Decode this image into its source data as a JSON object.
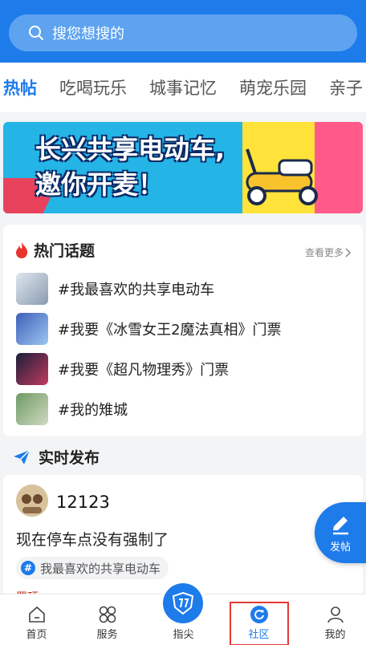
{
  "search": {
    "placeholder": "搜您想搜的"
  },
  "tabs": [
    {
      "label": "热帖",
      "active": true
    },
    {
      "label": "吃喝玩乐",
      "active": false
    },
    {
      "label": "城事记忆",
      "active": false
    },
    {
      "label": "萌宠乐园",
      "active": false
    },
    {
      "label": "亲子",
      "active": false
    }
  ],
  "banner": {
    "line1": "长兴共享电动车,",
    "line2": "邀你开麦！"
  },
  "hot_topics": {
    "title": "热门话题",
    "more_label": "查看更多",
    "items": [
      {
        "label": "#我最喜欢的共享电动车"
      },
      {
        "label": "#我要《冰雪女王2魔法真相》门票"
      },
      {
        "label": "#我要《超凡物理秀》门票"
      },
      {
        "label": "#我的雉城"
      }
    ]
  },
  "realtime": {
    "title": "实时发布"
  },
  "post": {
    "username": "12123",
    "text": "现在停车点没有强制了",
    "tag": "我最喜欢的共享电动车",
    "cut_text": "置顶"
  },
  "fab": {
    "label": "发帖"
  },
  "nav": {
    "items": [
      {
        "label": "首页"
      },
      {
        "label": "服务"
      },
      {
        "label": "指尖"
      },
      {
        "label": "社区"
      },
      {
        "label": "我的"
      }
    ]
  },
  "colors": {
    "primary": "#1e7bea",
    "highlight": "#e53935",
    "fire": "#e8352b"
  }
}
